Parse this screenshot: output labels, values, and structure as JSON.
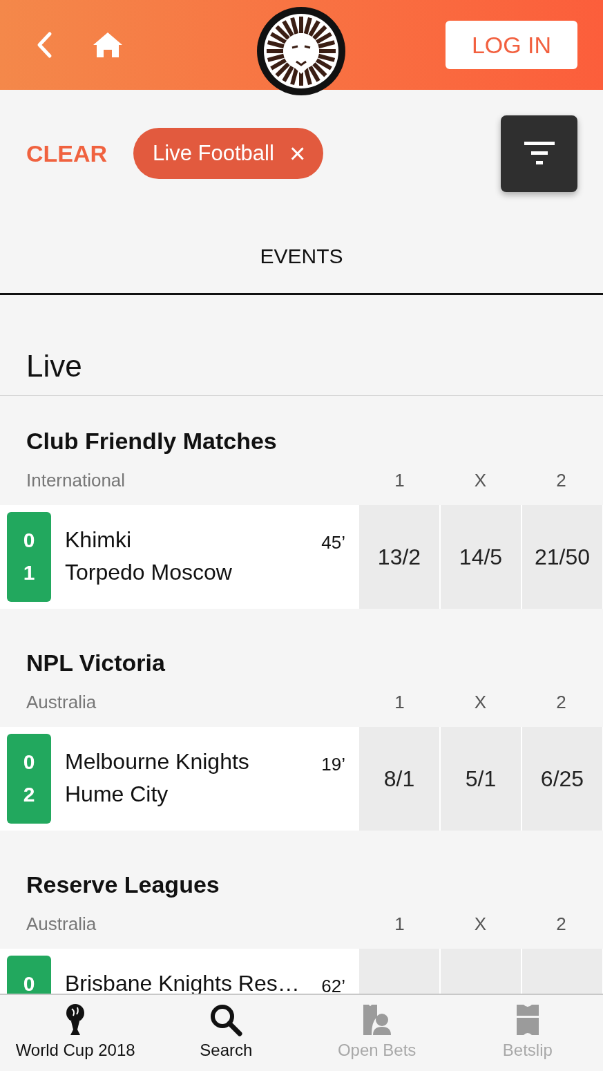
{
  "header": {
    "login_button": "LOG IN"
  },
  "filters": {
    "clear": "CLEAR",
    "chips": [
      {
        "label": "Live Football",
        "icon": "×"
      }
    ]
  },
  "tabs": [
    {
      "label": "EVENTS",
      "selected": true
    }
  ],
  "heading": "Live",
  "sections": [
    {
      "title": "Club Friendly Matches",
      "region": "International",
      "columns": [
        "1",
        "X",
        "2"
      ],
      "matches": [
        {
          "scores": [
            "0",
            "1"
          ],
          "teams": [
            "Khimki",
            "Torpedo Moscow"
          ],
          "minute": "45’",
          "odds": [
            "13/2",
            "14/5",
            "21/50"
          ]
        }
      ]
    },
    {
      "title": "NPL Victoria",
      "region": "Australia",
      "columns": [
        "1",
        "X",
        "2"
      ],
      "matches": [
        {
          "scores": [
            "0",
            "2"
          ],
          "teams": [
            "Melbourne Knights",
            "Hume City"
          ],
          "minute": "19’",
          "odds": [
            "8/1",
            "5/1",
            "6/25"
          ]
        }
      ]
    },
    {
      "title": "Reserve Leagues",
      "region": "Australia",
      "columns": [
        "1",
        "X",
        "2"
      ],
      "matches": [
        {
          "scores": [
            "0"
          ],
          "teams": [
            "Brisbane Knights Res…"
          ],
          "minute": "62’"
        }
      ]
    }
  ],
  "nav": [
    {
      "kind": "trophy",
      "label": "World Cup 2018",
      "disabled": false
    },
    {
      "kind": "search",
      "label": "Search",
      "disabled": false
    },
    {
      "kind": "openbets",
      "label": "Open Bets",
      "disabled": true
    },
    {
      "kind": "betslip",
      "label": "Betslip",
      "disabled": true
    }
  ]
}
